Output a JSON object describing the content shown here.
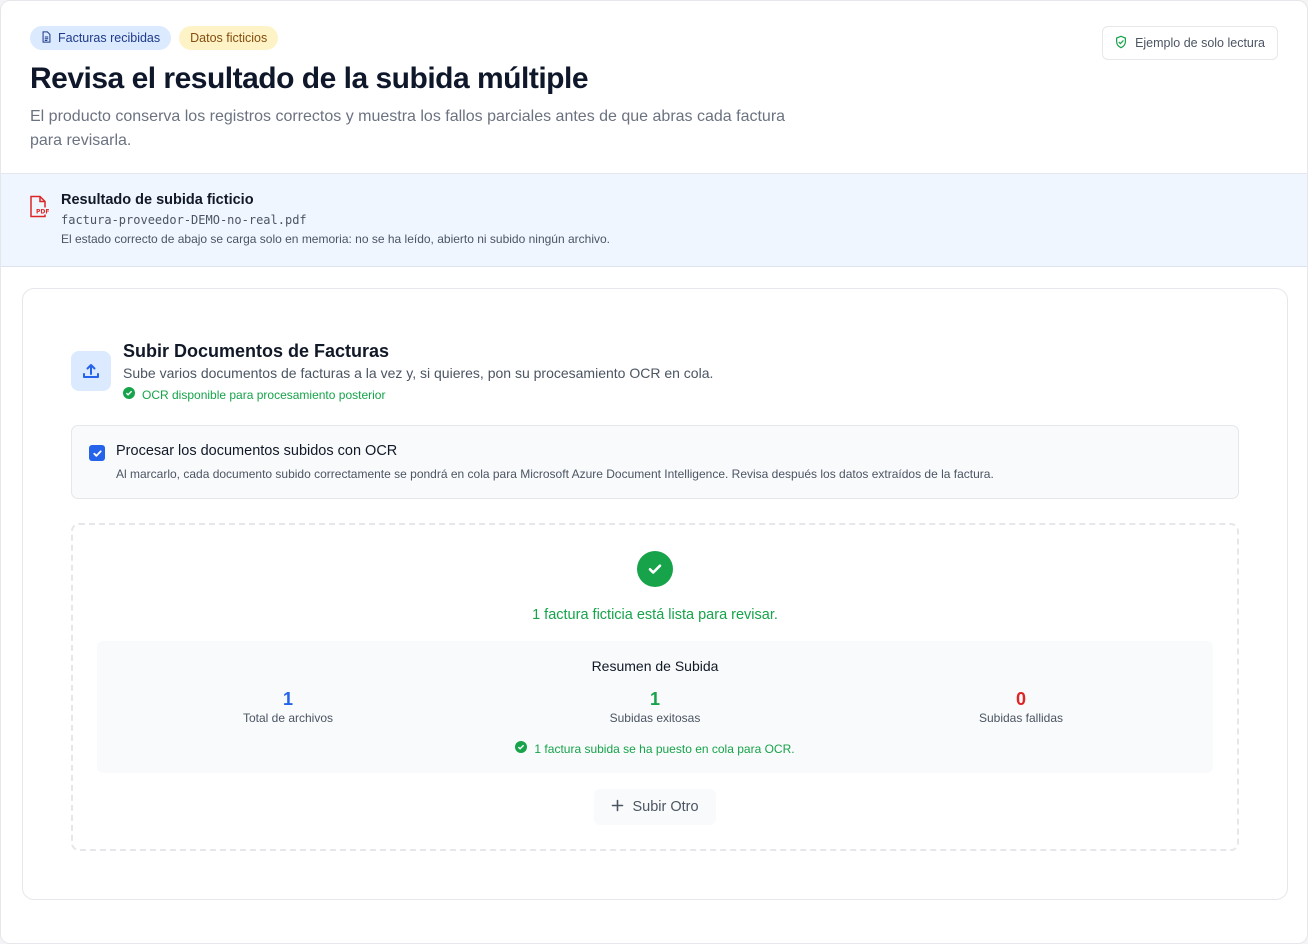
{
  "header": {
    "badges": {
      "received": "Facturas recibidas",
      "fictitious": "Datos ficticios"
    },
    "title": "Revisa el resultado de la subida múltiple",
    "subtitle": "El producto conserva los registros correctos y muestra los fallos parciales antes de que abras cada factura para revisarla.",
    "readonly_label": "Ejemplo de solo lectura"
  },
  "upload_result": {
    "title": "Resultado de subida ficticio",
    "filename": "factura-proveedor-DEMO-no-real.pdf",
    "note": "El estado correcto de abajo se carga solo en memoria: no se ha leído, abierto ni subido ningún archivo."
  },
  "upload_panel": {
    "title": "Subir Documentos de Facturas",
    "description": "Sube varios documentos de facturas a la vez y, si quieres, pon su procesamiento OCR en cola.",
    "ocr_status": "OCR disponible para procesamiento posterior",
    "ocr_option": {
      "label": "Procesar los documentos subidos con OCR",
      "checked": true,
      "help": "Al marcarlo, cada documento subido correctamente se pondrá en cola para Microsoft Azure Document Intelligence. Revisa después los datos extraídos de la factura."
    },
    "success_message": "1 factura ficticia está lista para revisar.",
    "summary": {
      "title": "Resumen de Subida",
      "total_value": "1",
      "total_label": "Total de archivos",
      "success_value": "1",
      "success_label": "Subidas exitosas",
      "failed_value": "0",
      "failed_label": "Subidas fallidas",
      "queued_message": "1 factura subida se ha puesto en cola para OCR."
    },
    "upload_another_label": "Subir Otro"
  },
  "colors": {
    "accent": "#2563eb",
    "success": "#16a34a",
    "danger": "#dc2626",
    "fictitious_badge": "#fef3c7"
  }
}
